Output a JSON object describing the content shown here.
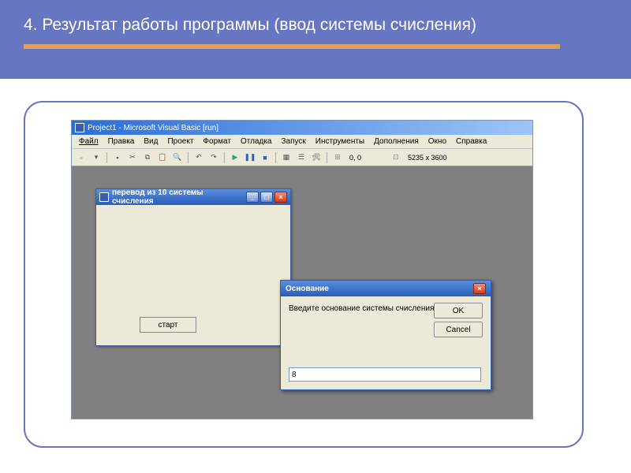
{
  "slide": {
    "title": "4. Результат работы программы (ввод системы счисления)"
  },
  "vb": {
    "title": "Project1 - Microsoft Visual Basic [run]",
    "menu": {
      "file": "Файл",
      "edit": "Правка",
      "view": "Вид",
      "project": "Проект",
      "format": "Формат",
      "debug": "Отладка",
      "run": "Запуск",
      "tools": "Инструменты",
      "addins": "Дополнения",
      "window": "Окно",
      "help": "Справка"
    },
    "coords1": "0, 0",
    "coords2": "5235 x 3600"
  },
  "form1": {
    "title": "перевод из 10 системы счисления",
    "start": "старт"
  },
  "inputbox": {
    "title": "Основание",
    "prompt": "Введите основание системы счисления",
    "ok": "OK",
    "cancel": "Cancel",
    "value": "8"
  }
}
